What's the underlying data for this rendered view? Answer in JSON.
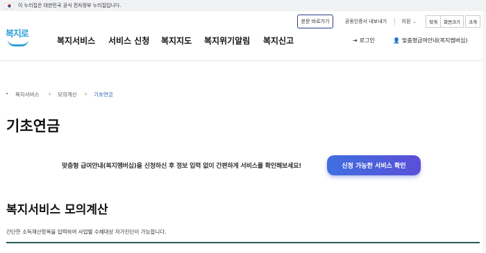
{
  "gov_banner": {
    "text": "이 누리집은 대한민국 공식 전자정부 누리집입니다."
  },
  "utility": {
    "skip_label": "본문 바로가기",
    "cert_label": "공동인증서 내보내기",
    "support_label": "지원",
    "font_small": "작게",
    "font_normal": "화면크기",
    "font_large": "크게"
  },
  "logo": {
    "text": "복지로"
  },
  "nav": {
    "items": [
      {
        "label": "복지서비스"
      },
      {
        "label": "서비스 신청"
      },
      {
        "label": "복지지도"
      },
      {
        "label": "복지위기알림"
      },
      {
        "label": "복지신고"
      }
    ],
    "login_label": "로그인",
    "member_label": "맞춤형급여안내(복지멤버십)"
  },
  "breadcrumb": {
    "items": [
      "복지서비스",
      "모의계산",
      "기초연금"
    ]
  },
  "page_title": "기초연금",
  "promo": {
    "text": "맞춤형 급여안내(복지멤버십)을 신청하신 후 정보 입력 없이 간편하게 서비스를 확인해보세요!",
    "button_label": "신청 가능한 서비스 확인"
  },
  "section": {
    "title": "복지서비스 모의계산",
    "description": "간단한 소득재산항목을 입력하여 사업별 수혜대상 자가진단이 가능합니다."
  },
  "colors": {
    "brand": "#2aa0d8",
    "accent": "#4a5fe0",
    "breadcrumb_active": "#2b5db8"
  }
}
